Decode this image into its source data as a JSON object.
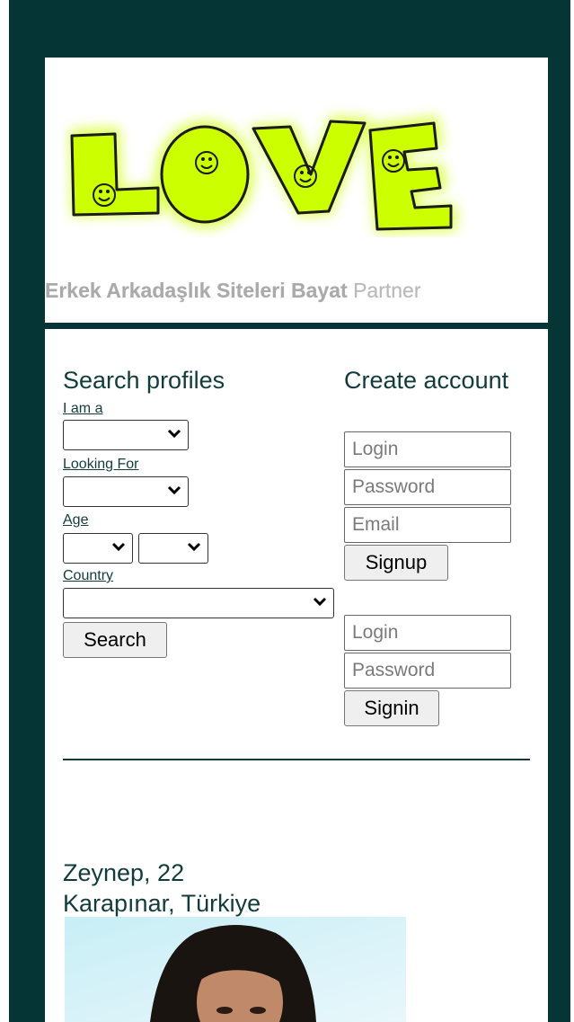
{
  "header": {
    "logo_text": "LOVE",
    "tagline_bold": "Erkek Arkadaşlık Siteleri Bayat",
    "tagline_rest": " Partner"
  },
  "search": {
    "title": "Search profiles",
    "i_am_label": "I am a",
    "looking_for_label": "Looking For",
    "age_label": "Age",
    "country_label": "Country",
    "button": "Search"
  },
  "signup": {
    "title": "Create account",
    "login_placeholder": "Login",
    "password_placeholder": "Password",
    "email_placeholder": "Email",
    "button": "Signup"
  },
  "signin": {
    "login_placeholder": "Login",
    "password_placeholder": "Password",
    "button": "Signin"
  },
  "profile": {
    "name_age": "Zeynep, 22",
    "location": "Karapınar, Türkiye"
  }
}
